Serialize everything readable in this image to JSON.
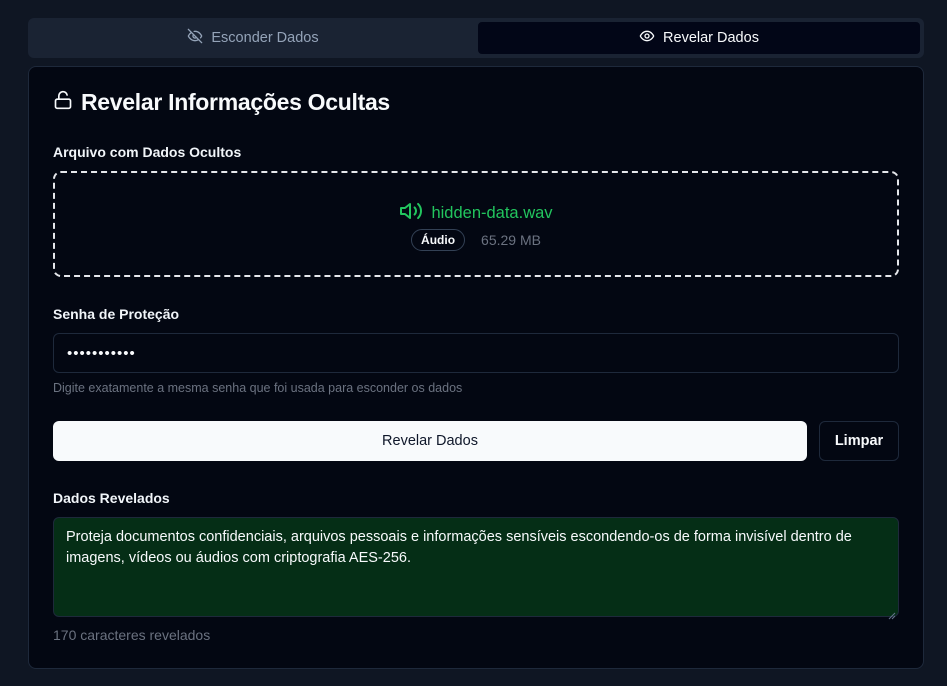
{
  "tabs": [
    {
      "label": "Esconder Dados",
      "icon": "eye-off-icon",
      "active": false
    },
    {
      "label": "Revelar Dados",
      "icon": "eye-icon",
      "active": true
    }
  ],
  "card": {
    "title": "Revelar Informações Ocultas",
    "title_icon": "unlock-icon",
    "file_section_label": "Arquivo com Dados Ocultos",
    "file": {
      "name": "hidden-data.wav",
      "icon": "volume-icon",
      "type_badge": "Áudio",
      "size": "65.29 MB"
    },
    "password_label": "Senha de Proteção",
    "password_value": "•••••••••••",
    "password_hint": "Digite exatamente a mesma senha que foi usada para esconder os dados",
    "reveal_button": "Revelar Dados",
    "clear_button": "Limpar",
    "output_label": "Dados Revelados",
    "output_text": "Proteja documentos confidenciais, arquivos pessoais e informações sensíveis escondendo-os de forma invisível dentro de imagens, vídeos ou áudios com criptografia AES-256.",
    "char_count": "170 caracteres revelados"
  },
  "colors": {
    "background": "#0f1623",
    "card": "#030712",
    "accent_green": "#22c55e",
    "output_bg": "#052e16"
  }
}
